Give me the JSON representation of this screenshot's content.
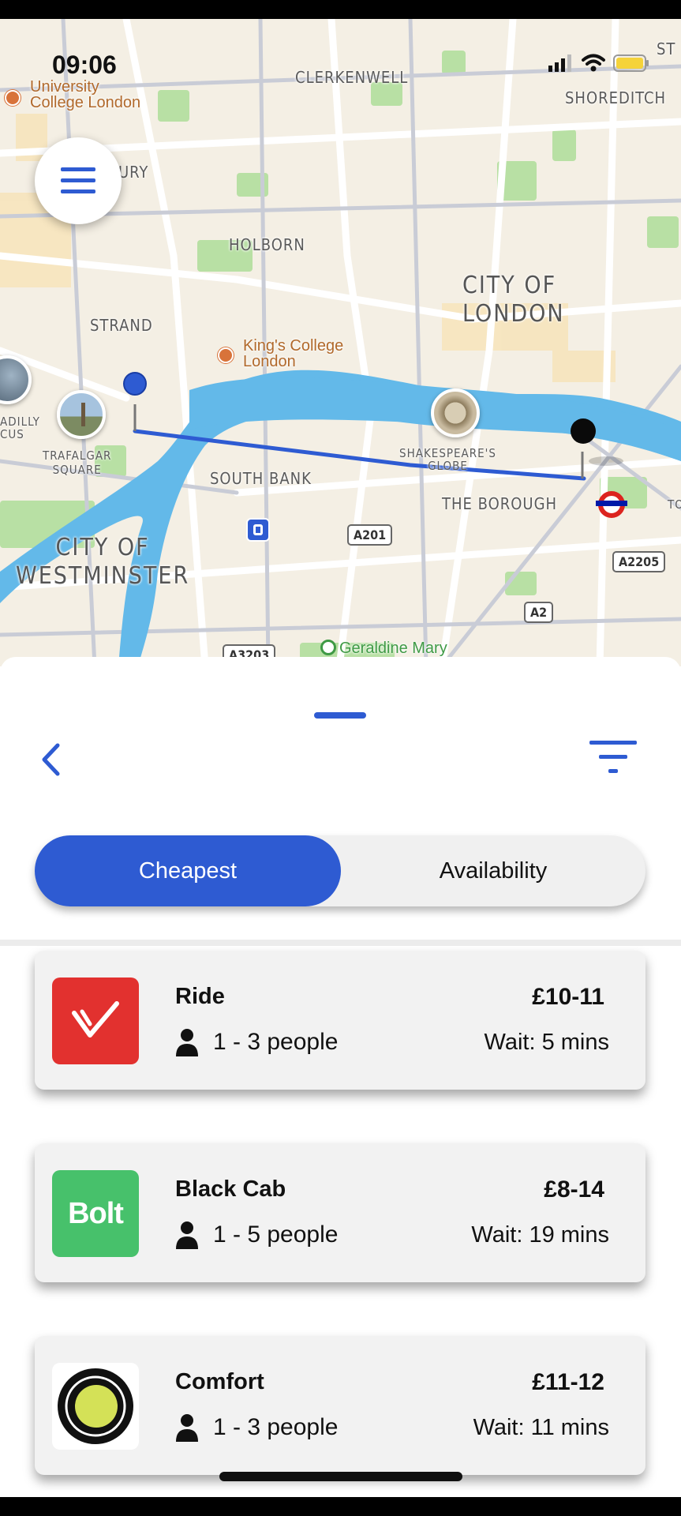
{
  "status_bar": {
    "time": "09:06"
  },
  "map": {
    "labels": {
      "clerkenwell": "CLERKENWELL",
      "shoreditch": "SHOREDITCH",
      "bury": "URY",
      "holborn": "HOLBORN",
      "city_of_london": "CITY OF\nLONDON",
      "strand": "STRAND",
      "piccadilly": "ADILLY\nCUS",
      "trafalgar": "TRAFALGAR\nSQUARE",
      "south_bank": "SOUTH BANK",
      "borough": "THE BOROUGH",
      "westminster": "CITY OF\nWESTMINSTER",
      "globe": "SHAKESPEARE'S\nGLOBE",
      "to": "TO",
      "st": "ST"
    },
    "pois": {
      "ucl": "University\nCollege London",
      "kings": "King's College\nLondon",
      "geraldine": "Geraldine Mary"
    },
    "roads": {
      "a201": "A201",
      "a2205": "A2205",
      "a2": "A2",
      "a3203": "A3203"
    }
  },
  "sheet": {
    "tabs": [
      {
        "label": "Cheapest",
        "active": true
      },
      {
        "label": "Availability",
        "active": false
      }
    ],
    "rides": [
      {
        "name": "Ride",
        "people": "1 - 3 people",
        "price": "£10-11",
        "wait": "Wait: 5 mins",
        "brand": "red-arrow"
      },
      {
        "name": "Black Cab",
        "people": "1 - 5 people",
        "price": "£8-14",
        "wait": "Wait: 19 mins",
        "brand": "bolt",
        "logo_text": "Bolt"
      },
      {
        "name": "Comfort",
        "people": "1 - 3 people",
        "price": "£11-12",
        "wait": "Wait: 11 mins",
        "brand": "ola-circle"
      }
    ]
  },
  "colors": {
    "accent": "#2e5bd2",
    "river": "#63b9e9",
    "map_bg": "#f4efe4",
    "park": "#b8e0a4"
  }
}
